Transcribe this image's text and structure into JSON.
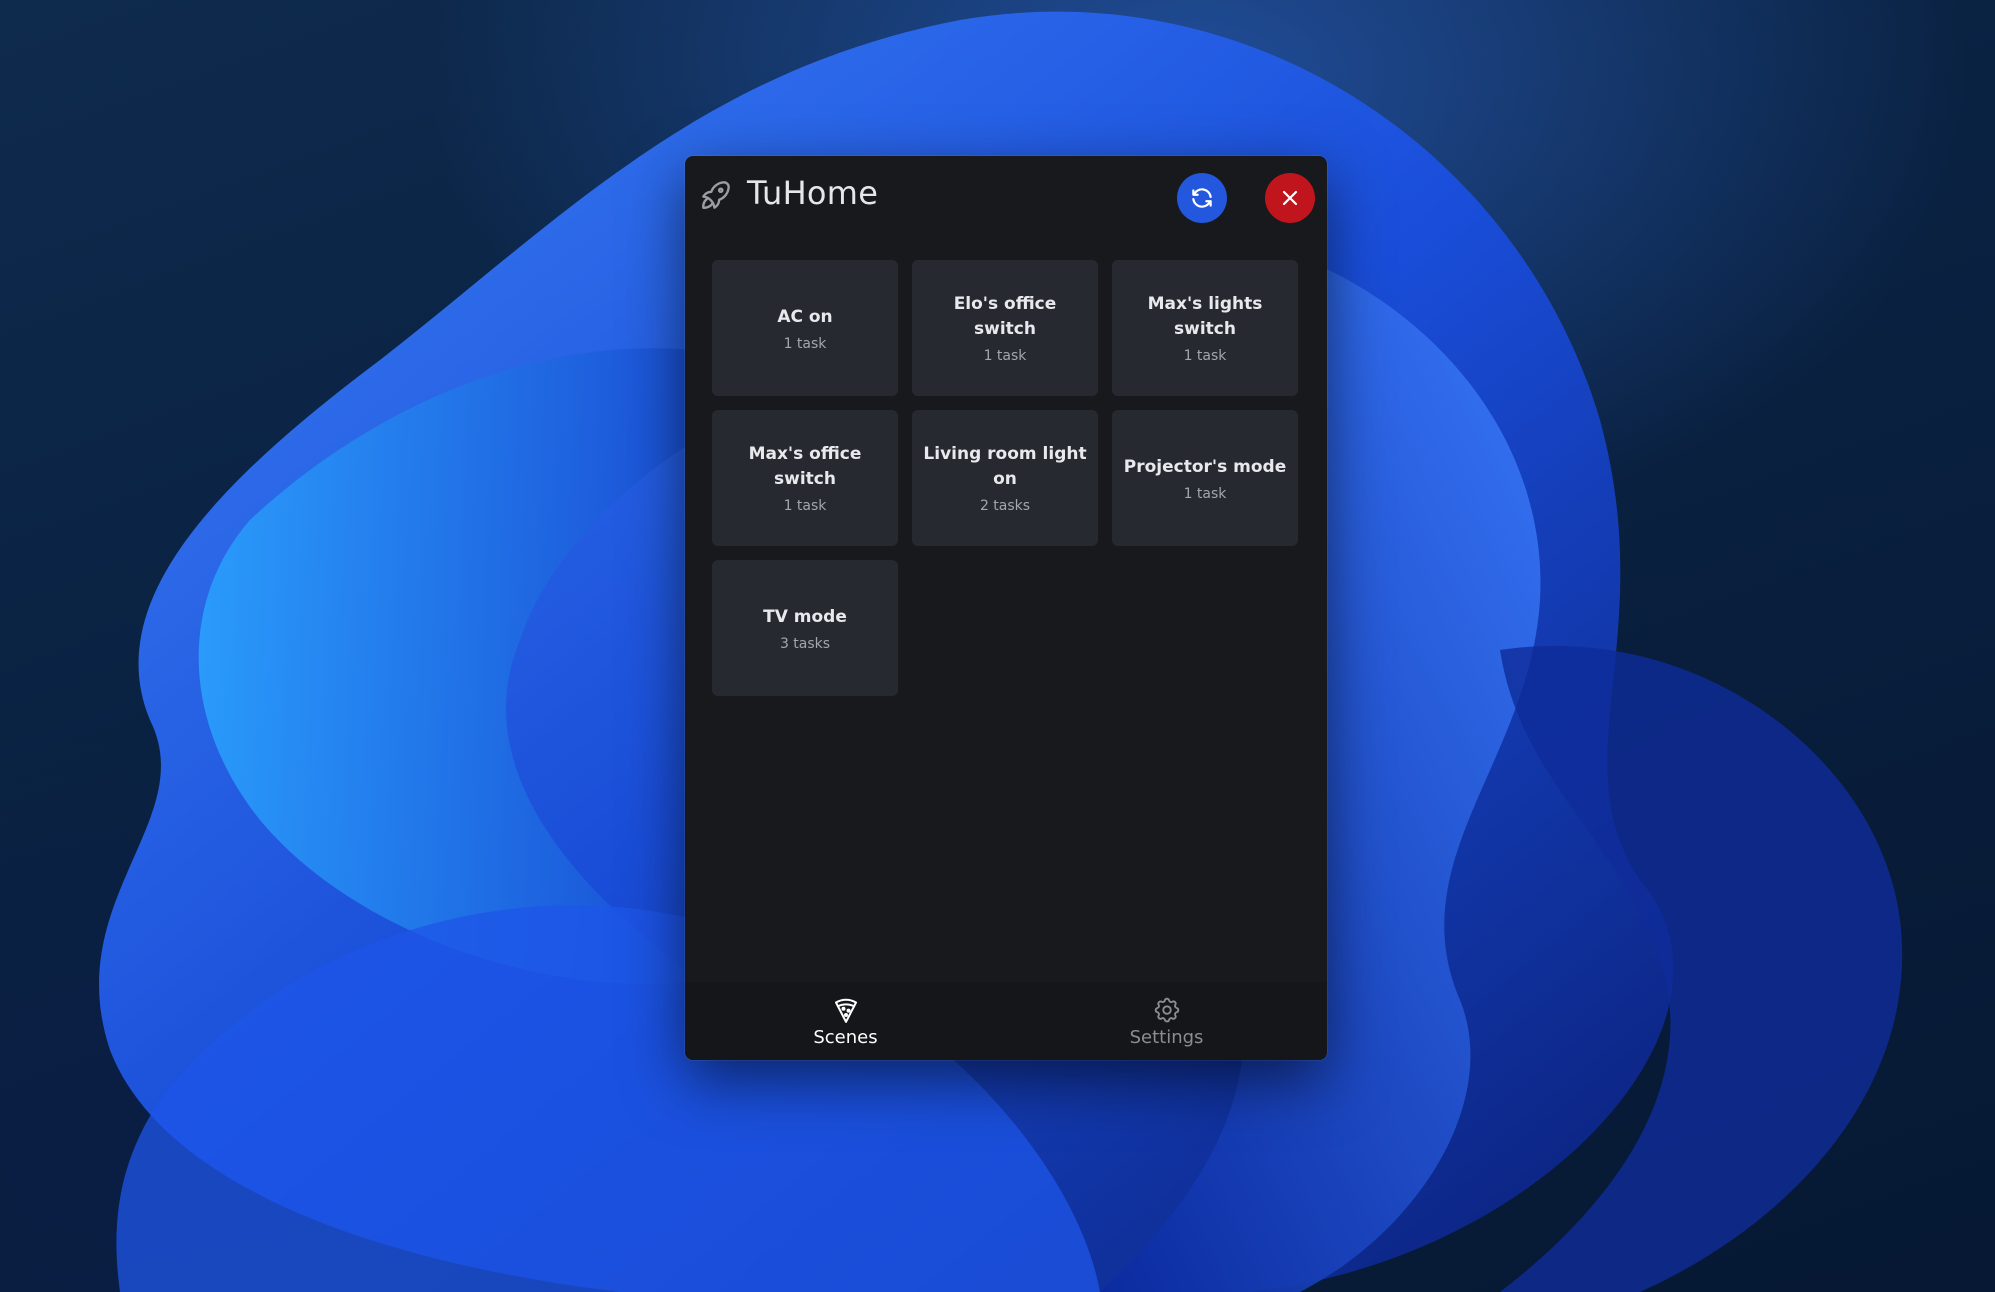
{
  "app": {
    "title": "TuHome",
    "icon": "rocket-icon"
  },
  "toolbar": {
    "refresh_icon": "refresh-icon",
    "close_icon": "close-icon",
    "refresh_color": "#2357dd",
    "close_color": "#c0151c"
  },
  "scenes": [
    {
      "name": "AC on",
      "tasks": "1 task"
    },
    {
      "name": "Elo's office switch",
      "tasks": "1 task"
    },
    {
      "name": "Max's lights switch",
      "tasks": "1 task"
    },
    {
      "name": "Max's office switch",
      "tasks": "1 task"
    },
    {
      "name": "Living room light on",
      "tasks": "2 tasks"
    },
    {
      "name": "Projector's mode",
      "tasks": "1 task"
    },
    {
      "name": "TV mode",
      "tasks": "3 tasks"
    }
  ],
  "nav": {
    "scenes_label": "Scenes",
    "scenes_icon": "pizza-icon",
    "settings_label": "Settings",
    "settings_icon": "gear-icon",
    "active": "Scenes"
  }
}
